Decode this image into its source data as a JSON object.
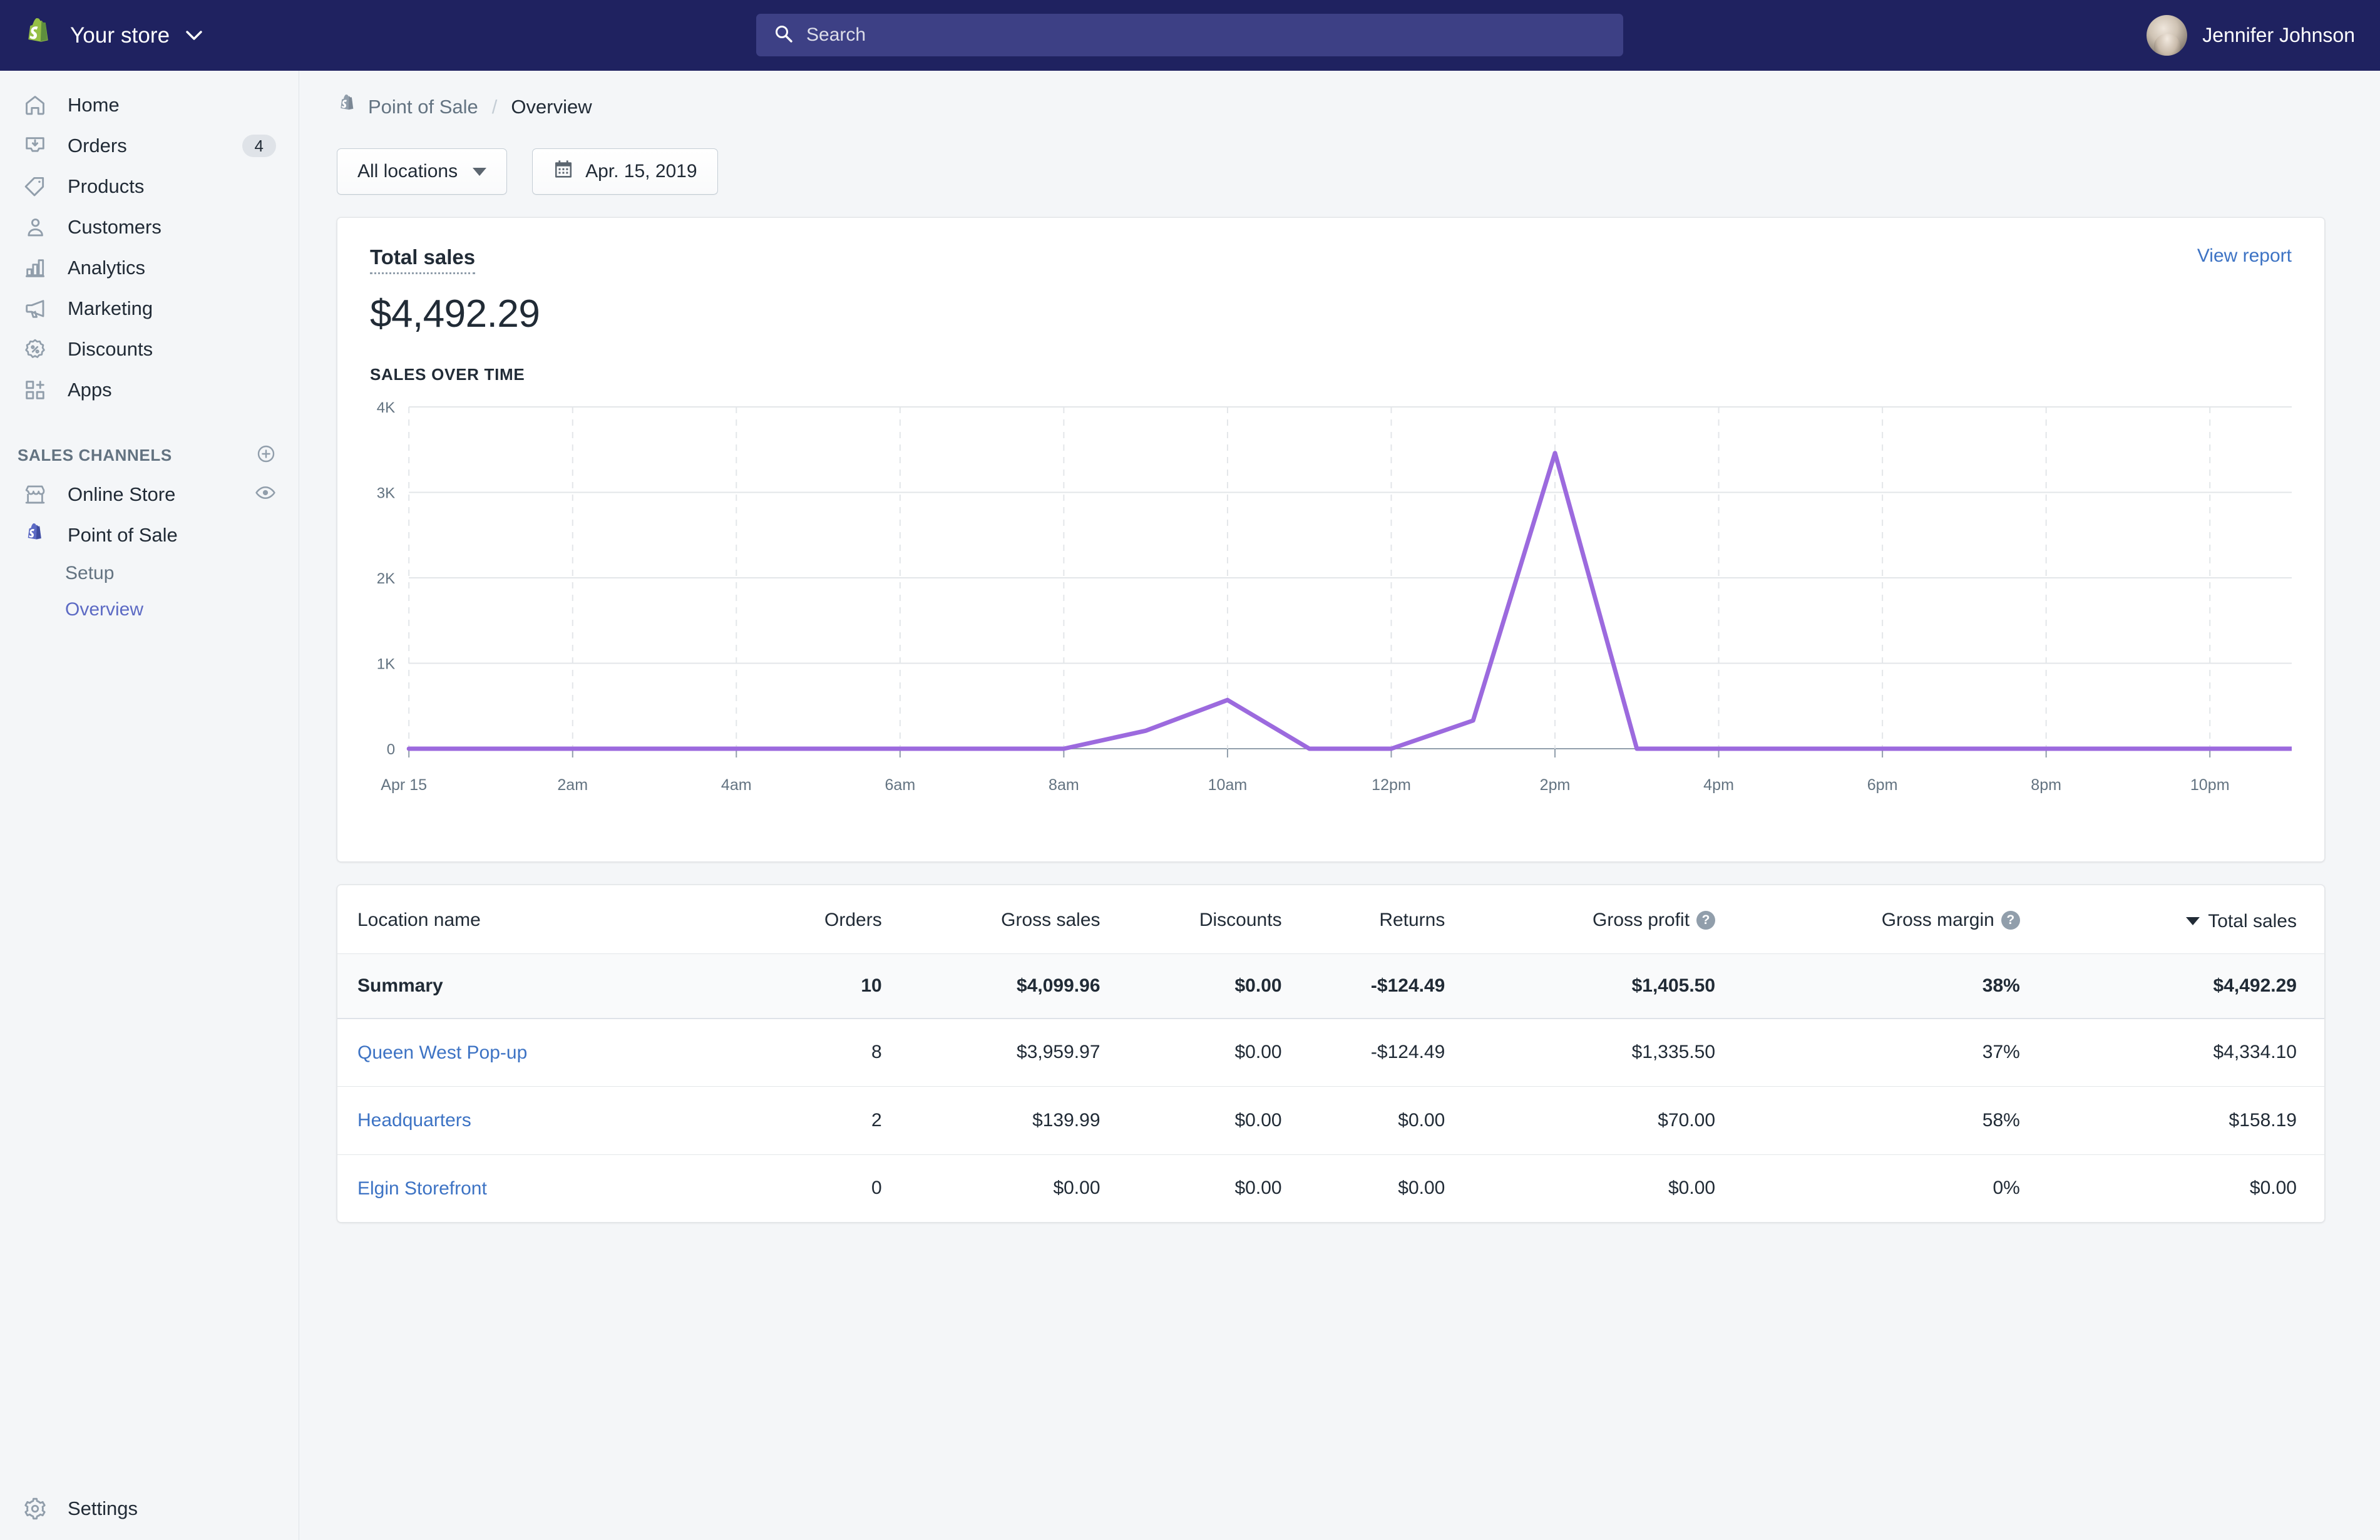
{
  "topbar": {
    "store_name": "Your store",
    "search_placeholder": "Search",
    "search_value": "",
    "user_name": "Jennifer Johnson"
  },
  "sidebar": {
    "items": [
      {
        "label": "Home",
        "icon": "home-icon",
        "badge": ""
      },
      {
        "label": "Orders",
        "icon": "orders-icon",
        "badge": "4"
      },
      {
        "label": "Products",
        "icon": "products-tag-icon",
        "badge": ""
      },
      {
        "label": "Customers",
        "icon": "customers-icon",
        "badge": ""
      },
      {
        "label": "Analytics",
        "icon": "analytics-bars-icon",
        "badge": ""
      },
      {
        "label": "Marketing",
        "icon": "marketing-megaphone-icon",
        "badge": ""
      },
      {
        "label": "Discounts",
        "icon": "discounts-badge-icon",
        "badge": ""
      },
      {
        "label": "Apps",
        "icon": "apps-grid-plus-icon",
        "badge": ""
      }
    ],
    "sales_channels_heading": "SALES CHANNELS",
    "channels": [
      {
        "label": "Online Store",
        "icon": "storefront-icon",
        "trailing_icon": "eye-icon"
      },
      {
        "label": "Point of Sale",
        "icon": "shopify-pos-bag-icon",
        "trailing_icon": ""
      }
    ],
    "pos_children": [
      {
        "label": "Setup",
        "active": false
      },
      {
        "label": "Overview",
        "active": true
      }
    ],
    "settings_label": "Settings"
  },
  "breadcrumb": {
    "parent": "Point of Sale",
    "separator": "/",
    "current": "Overview"
  },
  "filters": {
    "location": "All locations",
    "date": "Apr. 15, 2019"
  },
  "sales_card": {
    "title": "Total sales",
    "value": "$4,492.29",
    "view_report": "View report",
    "section_label": "SALES OVER TIME"
  },
  "chart_data": {
    "type": "line",
    "title": "Sales over time",
    "xlabel": "",
    "ylabel": "",
    "grid": true,
    "legend": "none",
    "line_color": "#9c6ade",
    "ylim": [
      0,
      4000
    ],
    "ytick_labels": [
      "0",
      "1K",
      "2K",
      "3K",
      "4K"
    ],
    "ytick_values": [
      0,
      1000,
      2000,
      3000,
      4000
    ],
    "xtick_labels": [
      "Apr 15",
      "2am",
      "4am",
      "6am",
      "8am",
      "10am",
      "12pm",
      "2pm",
      "4pm",
      "6pm",
      "8pm",
      "10pm"
    ],
    "x": [
      "12am",
      "1am",
      "2am",
      "3am",
      "4am",
      "5am",
      "6am",
      "7am",
      "8am",
      "9am",
      "10am",
      "11am",
      "12pm",
      "1pm",
      "2pm",
      "3pm",
      "4pm",
      "5pm",
      "6pm",
      "7pm",
      "8pm",
      "9pm",
      "10pm",
      "11pm"
    ],
    "values": [
      0,
      0,
      0,
      0,
      0,
      0,
      0,
      0,
      0,
      210,
      570,
      0,
      0,
      330,
      3460,
      0,
      0,
      0,
      0,
      0,
      0,
      0,
      0,
      0
    ]
  },
  "table": {
    "columns": [
      {
        "label": "Location name",
        "align": "left",
        "help": false,
        "sorted": false
      },
      {
        "label": "Orders",
        "align": "right",
        "help": false,
        "sorted": false
      },
      {
        "label": "Gross sales",
        "align": "right",
        "help": false,
        "sorted": false
      },
      {
        "label": "Discounts",
        "align": "right",
        "help": false,
        "sorted": false
      },
      {
        "label": "Returns",
        "align": "right",
        "help": false,
        "sorted": false
      },
      {
        "label": "Gross profit",
        "align": "right",
        "help": true,
        "sorted": false
      },
      {
        "label": "Gross margin",
        "align": "right",
        "help": true,
        "sorted": false
      },
      {
        "label": "Total sales",
        "align": "right",
        "help": false,
        "sorted": true
      }
    ],
    "help_icon_glyph": "?",
    "summary": {
      "name": "Summary",
      "orders": "10",
      "gross_sales": "$4,099.96",
      "discounts": "$0.00",
      "returns": "-$124.49",
      "gross_profit": "$1,405.50",
      "gross_margin": "38%",
      "total_sales": "$4,492.29"
    },
    "rows": [
      {
        "name": "Queen West Pop-up",
        "orders": "8",
        "gross_sales": "$3,959.97",
        "discounts": "$0.00",
        "returns": "-$124.49",
        "gross_profit": "$1,335.50",
        "gross_margin": "37%",
        "total_sales": "$4,334.10"
      },
      {
        "name": "Headquarters",
        "orders": "2",
        "gross_sales": "$139.99",
        "discounts": "$0.00",
        "returns": "$0.00",
        "gross_profit": "$70.00",
        "gross_margin": "58%",
        "total_sales": "$158.19"
      },
      {
        "name": "Elgin Storefront",
        "orders": "0",
        "gross_sales": "$0.00",
        "discounts": "$0.00",
        "returns": "$0.00",
        "gross_profit": "$0.00",
        "gross_margin": "0%",
        "total_sales": "$0.00"
      }
    ]
  }
}
